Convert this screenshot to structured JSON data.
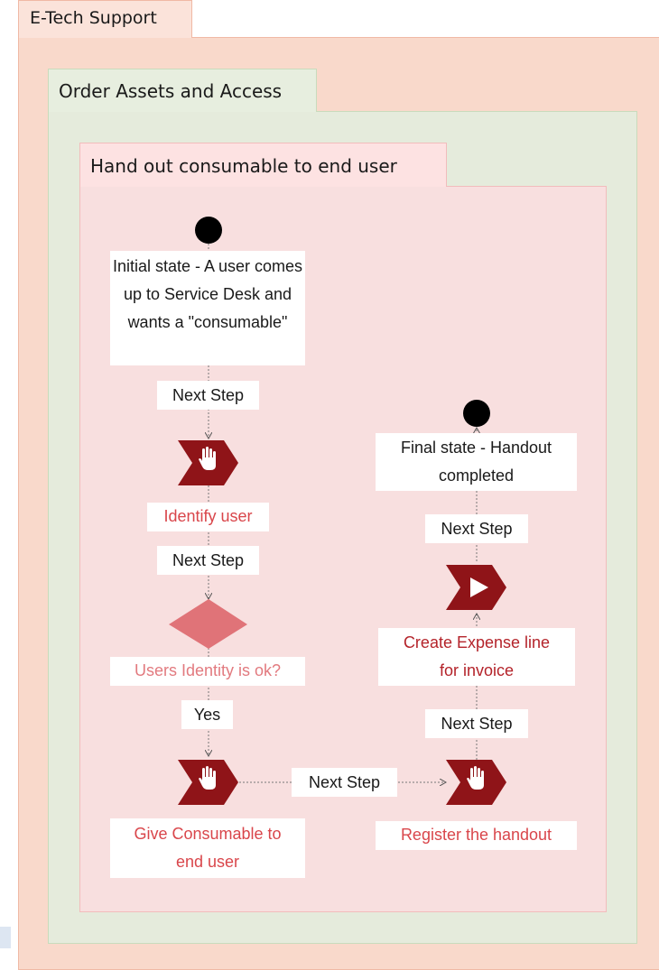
{
  "lanes": {
    "level1": {
      "label": "E-Tech Support"
    },
    "level2": {
      "label": "Order Assets and Access"
    },
    "level3": {
      "label": "Hand out consumable to end user"
    }
  },
  "nodes": {
    "initial_state": {
      "label": "Initial state - A user comes up to Service Desk and wants a \"consumable\""
    },
    "identify_user": {
      "label": "Identify user",
      "icon": "hand-stop-icon"
    },
    "identity_check": {
      "label": "Users Identity is ok?"
    },
    "give_consumable": {
      "label": "Give Consumable to end user",
      "icon": "hand-stop-icon"
    },
    "register_handout": {
      "label": "Register the handout",
      "icon": "hand-stop-icon"
    },
    "create_expense": {
      "label": "Create Expense line for invoice",
      "icon": "play-icon"
    },
    "final_state": {
      "label": "Final state - Handout completed"
    }
  },
  "edges": {
    "e1": {
      "label": "Next Step"
    },
    "e2": {
      "label": "Next Step"
    },
    "e3": {
      "label": "Yes"
    },
    "e4": {
      "label": "Next Step"
    },
    "e5": {
      "label": "Next Step"
    },
    "e6": {
      "label": "Next Step"
    }
  },
  "colors": {
    "task_shape": "#8f1418",
    "decision": "#e07378",
    "label_red": "#d9464b",
    "label_maroon": "#b4232a",
    "lane1": "#f9d9cb",
    "lane2": "#e5ebdc",
    "lane3": "#f8dfdf"
  }
}
